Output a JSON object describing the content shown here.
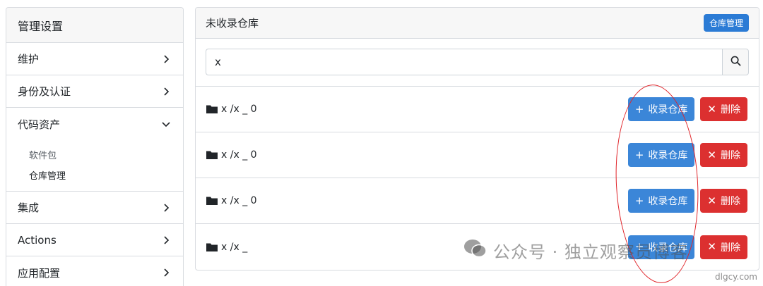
{
  "sidebar": {
    "title": "管理设置",
    "items": [
      {
        "label": "维护",
        "expanded": false
      },
      {
        "label": "身份及认证",
        "expanded": false
      },
      {
        "label": "代码资产",
        "expanded": true,
        "children": [
          {
            "label": "软件包"
          },
          {
            "label": "仓库管理"
          }
        ]
      },
      {
        "label": "集成",
        "expanded": false
      },
      {
        "label": "Actions",
        "expanded": false
      },
      {
        "label": "应用配置",
        "expanded": false
      }
    ]
  },
  "main": {
    "title": "未收录仓库",
    "manage_button": "仓库管理",
    "search": {
      "value": "x"
    },
    "rows": [
      {
        "name": "x  /x   _   0"
      },
      {
        "name": "x  /x   _   0"
      },
      {
        "name": "x  /x   _   0"
      },
      {
        "name": "x  /x   _  "
      }
    ],
    "include_label": "收录仓库",
    "delete_label": "删除"
  },
  "watermark": "公众号 · 独立观察员博客",
  "site": "dlgcy.com",
  "colors": {
    "primary": "#2b7bd5",
    "danger": "#dc3030",
    "annotation": "#e0252a"
  }
}
